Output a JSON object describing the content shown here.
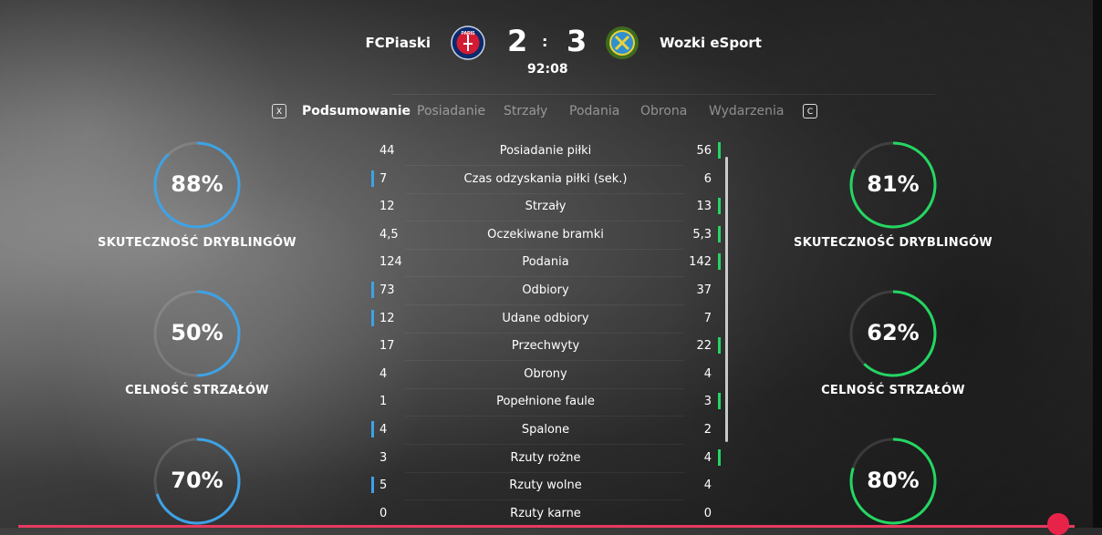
{
  "colors": {
    "home_accent": "#3ea2e6",
    "away_accent": "#24d662",
    "highlight": "#e8234a"
  },
  "header": {
    "home_team": "FCPiaski",
    "away_team": "Wozki eSport",
    "home_score": "2",
    "away_score": "3",
    "separator": ":",
    "clock": "92:08",
    "home_crest_text": "PARIS",
    "home_crest_icon": "psg-crest-icon",
    "away_crest_icon": "wozki-crest-icon"
  },
  "tabs": {
    "left_key": "X",
    "right_key": "C",
    "items": [
      {
        "label": "Podsumowanie",
        "active": true
      },
      {
        "label": "Posiadanie",
        "active": false
      },
      {
        "label": "Strzały",
        "active": false
      },
      {
        "label": "Podania",
        "active": false
      },
      {
        "label": "Obrona",
        "active": false
      },
      {
        "label": "Wydarzenia",
        "active": false
      }
    ]
  },
  "home_rings": [
    {
      "value": "88%",
      "label": "SKUTECZNOŚĆ DRYBLINGÓW",
      "fraction": 0.88
    },
    {
      "value": "50%",
      "label": "CELNOŚĆ STRZAŁÓW",
      "fraction": 0.5
    },
    {
      "value": "70%",
      "label": "",
      "fraction": 0.7
    }
  ],
  "away_rings": [
    {
      "value": "81%",
      "label": "SKUTECZNOŚĆ DRYBLINGÓW",
      "fraction": 0.81
    },
    {
      "value": "62%",
      "label": "CELNOŚĆ STRZAŁÓW",
      "fraction": 0.62
    },
    {
      "value": "80%",
      "label": "",
      "fraction": 0.8
    }
  ],
  "stats": [
    {
      "name": "Posiadanie piłki",
      "home": "44",
      "away": "56",
      "leader": "away"
    },
    {
      "name": "Czas odzyskania piłki (sek.)",
      "home": "7",
      "away": "6",
      "leader": "home"
    },
    {
      "name": "Strzały",
      "home": "12",
      "away": "13",
      "leader": "away"
    },
    {
      "name": "Oczekiwane bramki",
      "home": "4,5",
      "away": "5,3",
      "leader": "away"
    },
    {
      "name": "Podania",
      "home": "124",
      "away": "142",
      "leader": "away"
    },
    {
      "name": "Odbiory",
      "home": "73",
      "away": "37",
      "leader": "home"
    },
    {
      "name": "Udane odbiory",
      "home": "12",
      "away": "7",
      "leader": "home"
    },
    {
      "name": "Przechwyty",
      "home": "17",
      "away": "22",
      "leader": "away"
    },
    {
      "name": "Obrony",
      "home": "4",
      "away": "4",
      "leader": "none"
    },
    {
      "name": "Popełnione faule",
      "home": "1",
      "away": "3",
      "leader": "away"
    },
    {
      "name": "Spalone",
      "home": "4",
      "away": "2",
      "leader": "home"
    },
    {
      "name": "Rzuty rożne",
      "home": "3",
      "away": "4",
      "leader": "away"
    },
    {
      "name": "Rzuty wolne",
      "home": "5",
      "away": "4",
      "leader": "home"
    },
    {
      "name": "Rzuty karne",
      "home": "0",
      "away": "0",
      "leader": "none"
    }
  ]
}
